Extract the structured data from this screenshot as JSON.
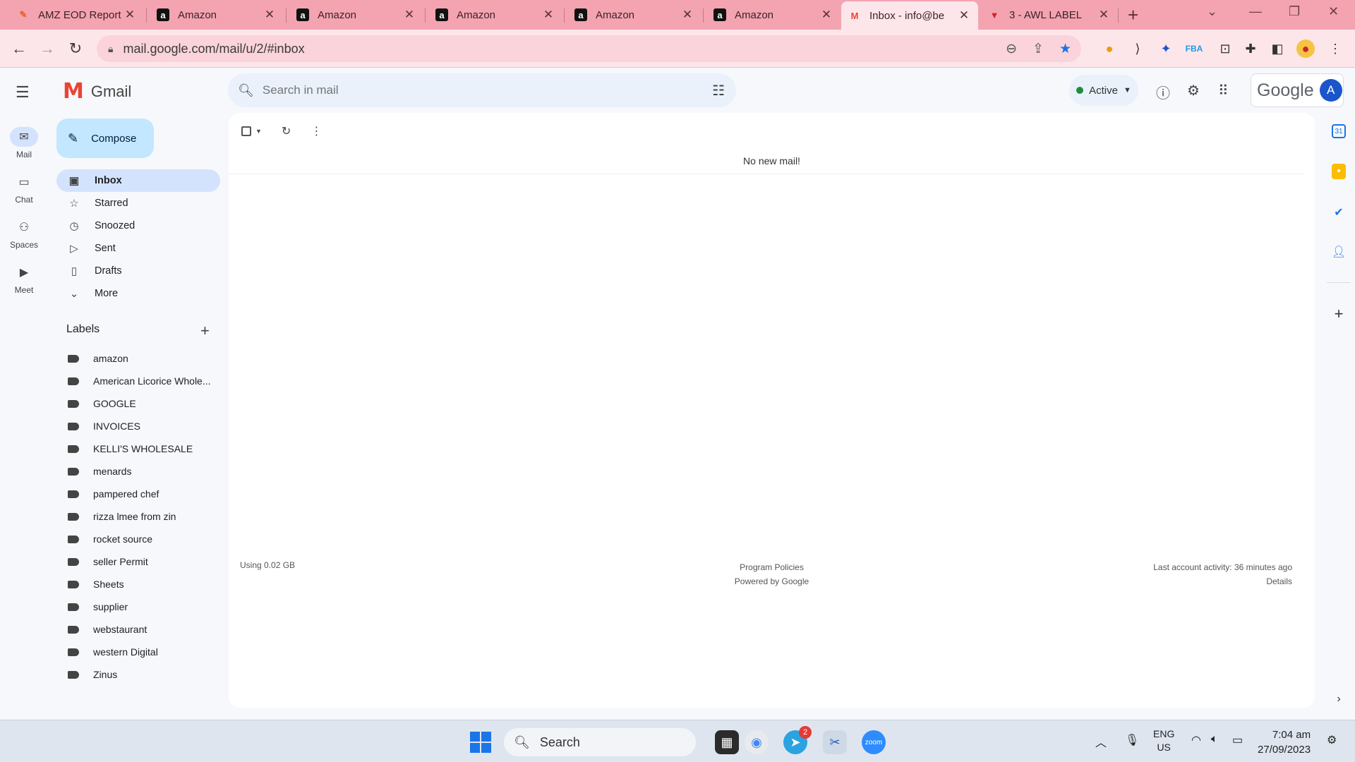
{
  "browser": {
    "tabs": [
      {
        "title": "AMZ EOD Report",
        "fav": "✎",
        "fav_color": "#e8632b"
      },
      {
        "title": "Amazon",
        "fav": "a",
        "fav_color": "#111111"
      },
      {
        "title": "Amazon",
        "fav": "a",
        "fav_color": "#111111"
      },
      {
        "title": "Amazon",
        "fav": "a",
        "fav_color": "#111111"
      },
      {
        "title": "Amazon",
        "fav": "a",
        "fav_color": "#111111"
      },
      {
        "title": "Amazon",
        "fav": "a",
        "fav_color": "#111111"
      },
      {
        "title": "Inbox - info@be",
        "fav": "M",
        "fav_color": "#ea4335"
      },
      {
        "title": "3 - AWL LABEL",
        "fav": "▼",
        "fav_color": "#d4212d"
      }
    ],
    "url": "mail.google.com/mail/u/2/#inbox"
  },
  "gmail": {
    "app_name": "Gmail",
    "rail": [
      {
        "label": "Mail",
        "icon": "mail-icon"
      },
      {
        "label": "Chat",
        "icon": "chat-icon"
      },
      {
        "label": "Spaces",
        "icon": "spaces-icon"
      },
      {
        "label": "Meet",
        "icon": "meet-icon"
      }
    ],
    "search_placeholder": "Search in mail",
    "status": "Active",
    "google_label": "Google",
    "avatar_letter": "A",
    "compose_label": "Compose",
    "nav": [
      {
        "label": "Inbox",
        "icon": "inbox-icon",
        "glyph": "▣"
      },
      {
        "label": "Starred",
        "icon": "star-icon",
        "glyph": "☆"
      },
      {
        "label": "Snoozed",
        "icon": "clock-icon",
        "glyph": "◷"
      },
      {
        "label": "Sent",
        "icon": "send-icon",
        "glyph": "▷"
      },
      {
        "label": "Drafts",
        "icon": "draft-icon",
        "glyph": "▯"
      },
      {
        "label": "More",
        "icon": "chevron-down-icon",
        "glyph": "⌄"
      }
    ],
    "labels_heading": "Labels",
    "labels": [
      "amazon",
      "American Licorice Whole...",
      "GOOGLE",
      "INVOICES",
      "KELLI'S WHOLESALE",
      "menards",
      "pampered chef",
      "rizza lmee from zin",
      "rocket source",
      "seller Permit",
      "Sheets",
      "supplier",
      "webstaurant",
      "western Digital",
      "Zinus"
    ],
    "empty_message": "No new mail!",
    "footer": {
      "storage": "Using 0.02 GB",
      "program_policies": "Program Policies",
      "powered_by": "Powered by Google",
      "last_activity": "Last account activity: 36 minutes ago",
      "details": "Details"
    }
  },
  "taskbar": {
    "search_label": "Search",
    "lang_top": "ENG",
    "lang_bottom": "US",
    "time": "7:04 am",
    "date": "27/09/2023",
    "telegram_badge": "2"
  }
}
